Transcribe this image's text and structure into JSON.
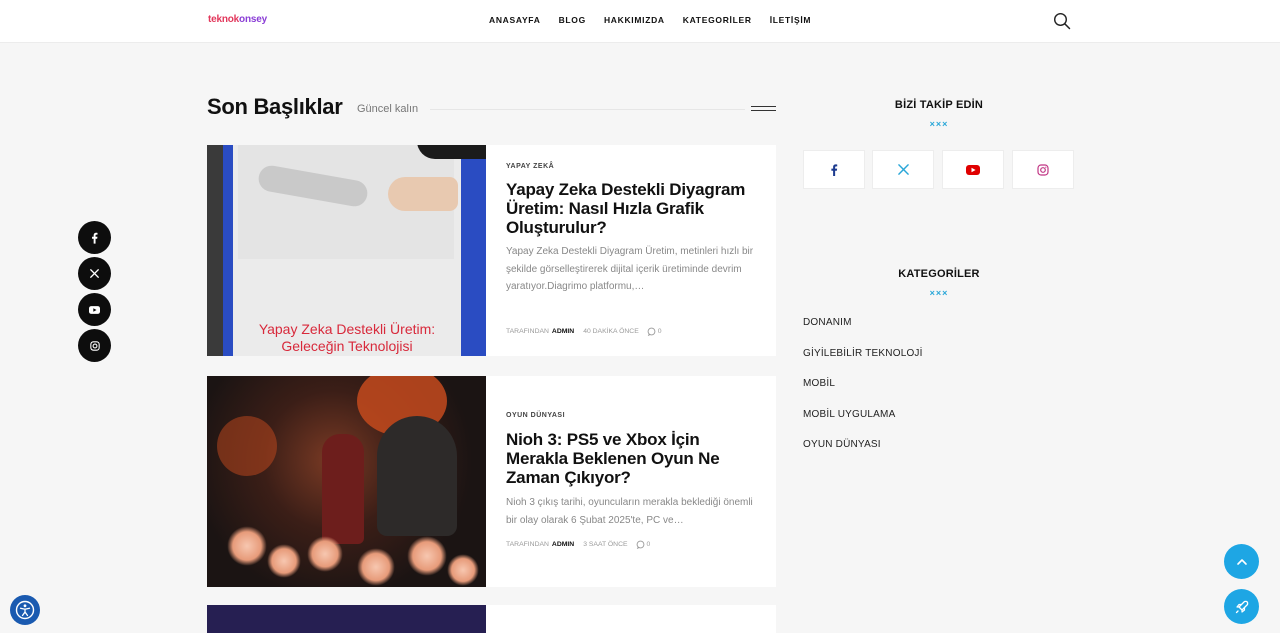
{
  "header": {
    "logo_part1": "teknok",
    "logo_part2": "onsey",
    "nav": [
      "ANASAYFA",
      "BLOG",
      "HAKKIMIZDA",
      "KATEGORİLER",
      "İLETİŞİM"
    ]
  },
  "section": {
    "title": "Son Başlıklar",
    "subtitle": "Güncel kalın"
  },
  "posts": [
    {
      "category": "YAPAY ZEKÂ",
      "title": "Yapay Zeka Destekli Diyagram Üretim: Nasıl Hızla Grafik Oluşturulur?",
      "excerpt": "Yapay Zeka Destekli Diyagram Üretim, metinleri hızlı bir şekilde görselleştirerek dijital içerik üretiminde devrim yaratıyor.Diagrimo platformu,…",
      "by": "TARAFINDAN",
      "author": "ADMIN",
      "age": "40 DAKİKA ÖNCE",
      "comments": "0",
      "image_caption_line1": "Yapay Zeka Destekli Üretim:",
      "image_caption_line2": "Geleceğin Teknolojisi"
    },
    {
      "category": "OYUN DÜNYASI",
      "title": "Nioh 3: PS5 ve Xbox İçin Merakla Beklenen Oyun Ne Zaman Çıkıyor?",
      "excerpt": "Nioh 3 çıkış tarihi, oyuncuların merakla beklediği önemli bir olay olarak 6 Şubat 2025'te, PC ve…",
      "by": "TARAFINDAN",
      "author": "ADMIN",
      "age": "3 SAAT ÖNCE",
      "comments": "0"
    }
  ],
  "sidebar": {
    "follow_title": "BİZİ TAKİP EDİN",
    "categories_title": "KATEGORİLER",
    "decoration": "×××",
    "categories": [
      "DONANIM",
      "GİYİLEBİLİR TEKNOLOJİ",
      "MOBİL",
      "MOBİL UYGULAMA",
      "OYUN DÜNYASI"
    ]
  },
  "colors": {
    "accent": "#1ea6e4",
    "facebook": "#1d3b8f",
    "twitter": "#2aa7d8",
    "youtube": "#e00000",
    "instagram": "#c13584"
  },
  "icons": {
    "floating_left": [
      "facebook-icon",
      "x-icon",
      "youtube-icon",
      "instagram-icon"
    ],
    "fab": [
      "chevron-up-icon",
      "rocket-icon"
    ],
    "accessibility": "accessibility-icon"
  }
}
